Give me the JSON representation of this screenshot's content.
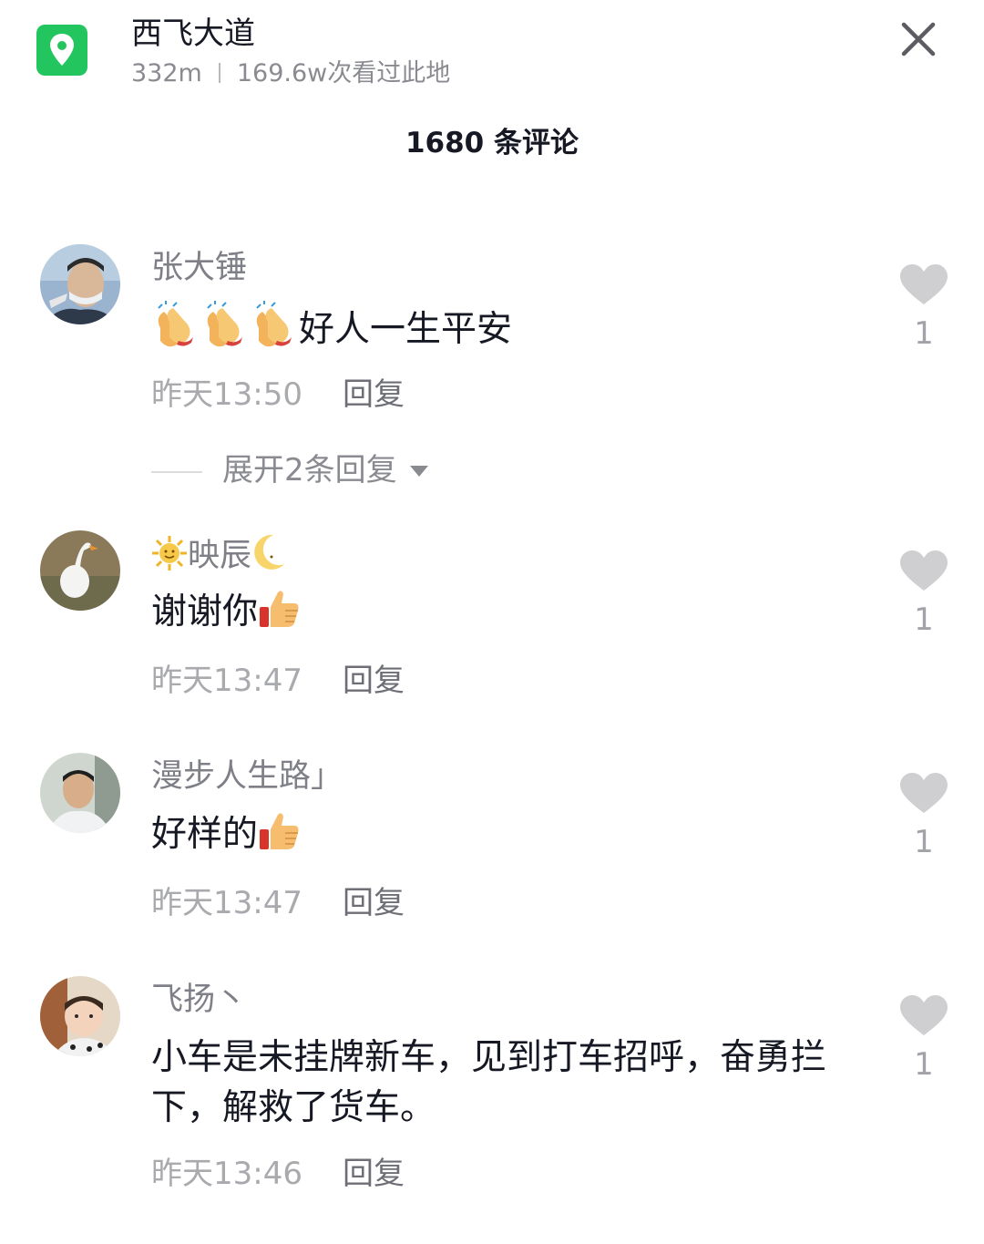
{
  "header": {
    "location_name": "西飞大道",
    "distance": "332m",
    "views": "169.6w次看过此地",
    "accent_color": "#22c55e"
  },
  "comments_title": "1680 条评论",
  "comments": [
    {
      "username": "张大锤",
      "text": "好人一生平安",
      "text_emoji": "clapping-hands x3",
      "time": "昨天13:50",
      "reply_label": "回复",
      "likes": "1",
      "expand_label": "展开2条回复"
    },
    {
      "username": "映辰",
      "username_emoji": "sun-face, crescent-moon",
      "text": "谢谢你",
      "text_emoji": "thumbs-up",
      "time": "昨天13:47",
      "reply_label": "回复",
      "likes": "1"
    },
    {
      "username": "漫步人生路」",
      "text": "好样的",
      "text_emoji": "thumbs-up",
      "time": "昨天13:47",
      "reply_label": "回复",
      "likes": "1"
    },
    {
      "username": "飞扬丶",
      "text": "小车是未挂牌新车，见到打车招呼，奋勇拦下，解救了货车。",
      "time": "昨天13:46",
      "reply_label": "回复",
      "likes": "1"
    }
  ]
}
